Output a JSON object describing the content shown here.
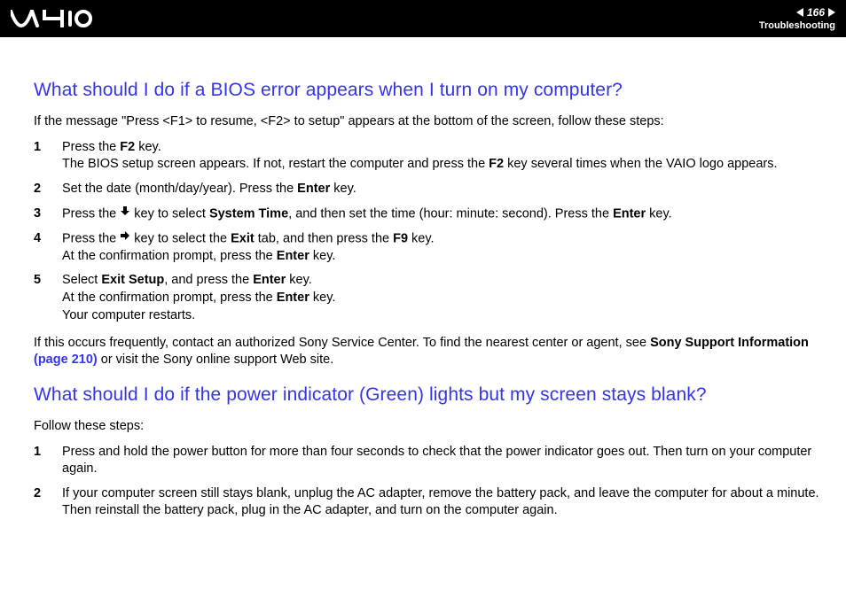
{
  "header": {
    "page_number": "166",
    "section": "Troubleshooting"
  },
  "section1": {
    "heading": "What should I do if a BIOS error appears when I turn on my computer?",
    "intro": "If the message \"Press <F1> to resume, <F2> to setup\" appears at the bottom of the screen, follow these steps:",
    "steps": [
      {
        "num": "1",
        "t1": "Press the ",
        "b1": "F2",
        "t2": " key.",
        "line2a": "The BIOS setup screen appears. If not, restart the computer and press the ",
        "line2b": "F2",
        "line2c": " key several times when the VAIO logo appears."
      },
      {
        "num": "2",
        "t1": "Set the date (month/day/year). Press the ",
        "b1": "Enter",
        "t2": " key."
      },
      {
        "num": "3",
        "t1": "Press the ",
        "icon": "down",
        "t2": " key to select ",
        "b1": "System Time",
        "t3": ", and then set the time (hour: minute: second). Press the ",
        "b2": "Enter",
        "t4": " key."
      },
      {
        "num": "4",
        "t1": "Press the ",
        "icon": "right",
        "t2": " key to select the ",
        "b1": "Exit",
        "t3": " tab, and then press the ",
        "b2": "F9",
        "t4": " key.",
        "line2a": "At the confirmation prompt, press the ",
        "line2b": "Enter",
        "line2c": " key."
      },
      {
        "num": "5",
        "t1": "Select ",
        "b1": "Exit Setup",
        "t2": ", and press the ",
        "b2": "Enter",
        "t3": " key.",
        "line2a": "At the confirmation prompt, press the ",
        "line2b": "Enter",
        "line2c": " key.",
        "line3": "Your computer restarts."
      }
    ],
    "outro1": "If this occurs frequently, contact an authorized Sony Service Center. To find the nearest center or agent, see ",
    "outro_bold": "Sony Support Information ",
    "outro_link": "(page 210)",
    "outro2": " or visit the Sony online support Web site."
  },
  "section2": {
    "heading": "What should I do if the power indicator (Green) lights but my screen stays blank?",
    "intro": "Follow these steps:",
    "steps": [
      {
        "num": "1",
        "text": "Press and hold the power button for more than four seconds to check that the power indicator goes out. Then turn on your computer again."
      },
      {
        "num": "2",
        "text": "If your computer screen still stays blank, unplug the AC adapter, remove the battery pack, and leave the computer for about a minute. Then reinstall the battery pack, plug in the AC adapter, and turn on the computer again."
      }
    ]
  }
}
